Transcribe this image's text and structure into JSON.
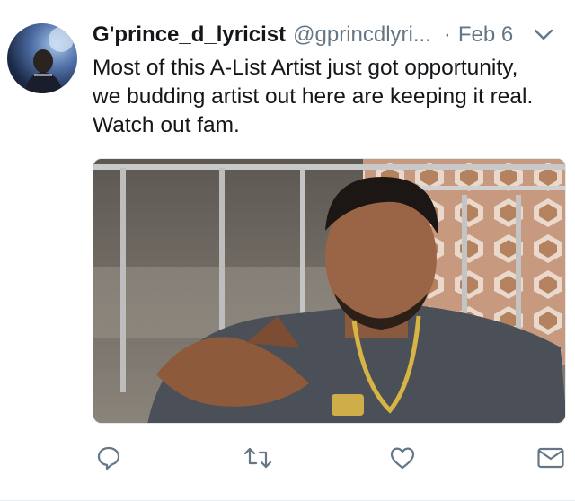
{
  "tweet": {
    "display_name": "G'prince_d_lyricist",
    "handle": "@gprincdlyri...",
    "separator": "·",
    "date": "Feb 6",
    "text_lines": [
      "Most of this A-List Artist just got opportunity,",
      "we budding artist out here are keeping it real.",
      "Watch out fam."
    ]
  },
  "icons": {
    "caret": "chevron-down-icon",
    "reply": "reply-icon",
    "retweet": "retweet-icon",
    "like": "heart-icon",
    "dm": "envelope-icon"
  },
  "colors": {
    "name": "#14171a",
    "secondary": "#657786",
    "icon": "#657786",
    "border": "#e6ecf0"
  }
}
